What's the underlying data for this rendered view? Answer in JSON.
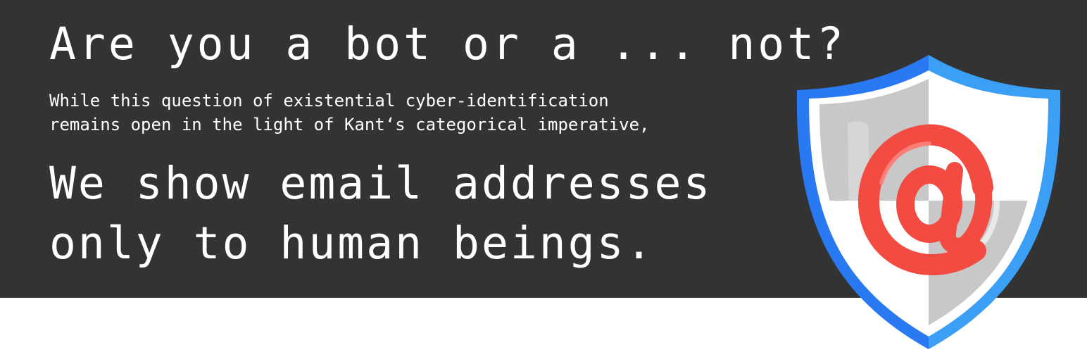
{
  "banner": {
    "headline": "Are you a bot or a ... not?",
    "subtext_lines": [
      "While this question of existential cyber-identification",
      "remains open in the light of Kant‘s categorical imperative,"
    ],
    "statement_lines": [
      "We show email addresses",
      "only to human beings."
    ]
  },
  "colors": {
    "banner_background": "#333333",
    "text": "#ffffff",
    "shield_blue_dark": "#2979f2",
    "shield_blue_light": "#3a9ff5",
    "shield_grey": "#c8c8c8",
    "at_sign_red": "#f34a42"
  },
  "icons": {
    "shield": "shield-icon",
    "at_sign": "at-sign-icon"
  }
}
